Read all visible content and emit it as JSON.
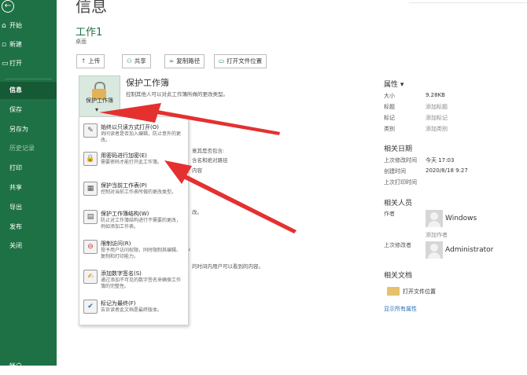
{
  "sidebar": {
    "items": [
      {
        "label": "开始",
        "icon": "home-icon"
      },
      {
        "label": "新建",
        "icon": "new-doc-icon"
      },
      {
        "label": "打开",
        "icon": "folder-open-icon"
      },
      {
        "label": "信息",
        "icon": ""
      },
      {
        "label": "保存",
        "icon": ""
      },
      {
        "label": "另存为",
        "icon": ""
      },
      {
        "label": "历史记录",
        "icon": ""
      },
      {
        "label": "打印",
        "icon": ""
      },
      {
        "label": "共享",
        "icon": ""
      },
      {
        "label": "导出",
        "icon": ""
      },
      {
        "label": "发布",
        "icon": ""
      },
      {
        "label": "关闭",
        "icon": ""
      },
      {
        "label": "帐户",
        "icon": ""
      }
    ]
  },
  "page": {
    "title": "信息",
    "doc_name": "工作1",
    "doc_location": "桌面"
  },
  "toolbar": {
    "upload": "上传",
    "share": "共享",
    "copy_path": "复制路径",
    "open_location": "打开文件位置"
  },
  "protect": {
    "tile_label": "保护工作簿",
    "title": "保护工作簿",
    "description": "控制其他人可以对此工作簿所做的更改类型。"
  },
  "background_texts": [
    "意其是否包含:",
    "含名和绝对路径",
    "内容",
    "改。",
    "的时间内用户可以看到的内容。"
  ],
  "menu": {
    "items": [
      {
        "title": "始终以只读方式打开(O)",
        "desc": "询问读者是否加入编辑，防止意外的更改。",
        "icon": "pencil-icon"
      },
      {
        "title": "用密码进行加密(E)",
        "desc": "需要密码才能打开此工作簿。",
        "icon": "lock-icon"
      },
      {
        "title": "保护当前工作表(P)",
        "desc": "控制对当前工作表所做的更改类型。",
        "icon": "sheet-icon"
      },
      {
        "title": "保护工作簿结构(W)",
        "desc": "防止对工作簿结构进行不需要的更改，例如添加工作表。",
        "icon": "workbook-icon"
      },
      {
        "title": "限制访问(R)",
        "desc": "授予用户访问权限，同时限制其编辑、复制和打印能力。",
        "icon": "restrict-icon"
      },
      {
        "title": "添加数字签名(S)",
        "desc": "通过添加不可见的数字签名来确保工作簿的完整性。",
        "icon": "signature-icon"
      },
      {
        "title": "标记为最终(F)",
        "desc": "告诉读者此文档是最终版本。",
        "icon": "final-icon"
      }
    ]
  },
  "properties": {
    "header": "属性",
    "rows": [
      {
        "label": "大小",
        "value": "9.28KB"
      },
      {
        "label": "标题",
        "value": "添加标题"
      },
      {
        "label": "标记",
        "value": "添加标记"
      },
      {
        "label": "类别",
        "value": "添加类别"
      }
    ]
  },
  "dates": {
    "header": "相关日期",
    "rows": [
      {
        "label": "上次修改时间",
        "value": "今天 17:03"
      },
      {
        "label": "创建时间",
        "value": "2020/8/18 9:27"
      },
      {
        "label": "上次打印时间",
        "value": ""
      }
    ]
  },
  "people": {
    "header": "相关人员",
    "author_label": "作者",
    "author": "Windows",
    "add_author": "添加作者",
    "modifier_label": "上次修改者",
    "modifier": "Administrator"
  },
  "docs": {
    "header": "相关文档",
    "open_location": "打开文件位置",
    "show_all": "显示所有属性"
  },
  "colors": {
    "sidebar": "#1e7145",
    "accent_arrow": "#e53030",
    "link": "#2b6fb8"
  }
}
